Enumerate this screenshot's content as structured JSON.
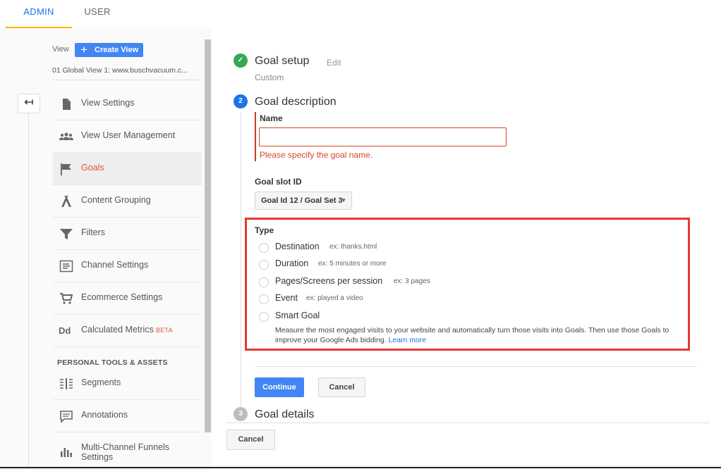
{
  "tabs": {
    "admin": "ADMIN",
    "user": "USER"
  },
  "view": {
    "label": "View",
    "create_button": "Create View",
    "create_plus": "+",
    "selected": "01 Global View 1: www.buschvacuum.c..."
  },
  "back_button": "↤",
  "nav": [
    {
      "label": "View Settings",
      "icon": "document-icon"
    },
    {
      "label": "View User Management",
      "icon": "people-icon"
    },
    {
      "label": "Goals",
      "icon": "flag-icon",
      "active": true
    },
    {
      "label": "Content Grouping",
      "icon": "content-grouping-icon"
    },
    {
      "label": "Filters",
      "icon": "filter-icon"
    },
    {
      "label": "Channel Settings",
      "icon": "channel-settings-icon"
    },
    {
      "label": "Ecommerce Settings",
      "icon": "cart-icon"
    },
    {
      "label": "Calculated Metrics",
      "icon": "dd-icon",
      "badge": "BETA",
      "icon_text": "Dd"
    },
    {
      "label": "Segments",
      "icon": "segments-icon"
    },
    {
      "label": "Annotations",
      "icon": "annotation-icon"
    },
    {
      "label": "Multi-Channel Funnels Settings",
      "icon": "bar-chart-icon"
    }
  ],
  "section_personal": "PERSONAL TOOLS & ASSETS",
  "steps": {
    "setup": {
      "title": "Goal setup",
      "edit": "Edit",
      "sub": "Custom",
      "check": "✓"
    },
    "description": {
      "number": "2",
      "title": "Goal description"
    },
    "details": {
      "number": "3",
      "title": "Goal details"
    }
  },
  "form": {
    "name_label": "Name",
    "name_value": "",
    "name_error": "Please specify the goal name.",
    "slot_label": "Goal slot ID",
    "slot_value": "Goal Id 12 / Goal Set 3",
    "type_label": "Type",
    "types": [
      {
        "label": "Destination",
        "example": "ex: thanks.html"
      },
      {
        "label": "Duration",
        "example": "ex: 5 minutes or more"
      },
      {
        "label": "Pages/Screens per session",
        "example": "ex: 3 pages"
      },
      {
        "label": "Event",
        "example": "ex: played a video"
      },
      {
        "label": "Smart Goal",
        "example": ""
      }
    ],
    "smart_desc": "Measure the most engaged visits to your website and automatically turn those visits into Goals. Then use those Goals to improve your Google Ads bidding.",
    "learn_more": "Learn more"
  },
  "buttons": {
    "continue": "Continue",
    "cancel": "Cancel",
    "cancel_outer": "Cancel"
  },
  "colors": {
    "accent": "#4285f4",
    "error": "#d9452b",
    "highlight_box": "#e53935",
    "success": "#34a853"
  }
}
